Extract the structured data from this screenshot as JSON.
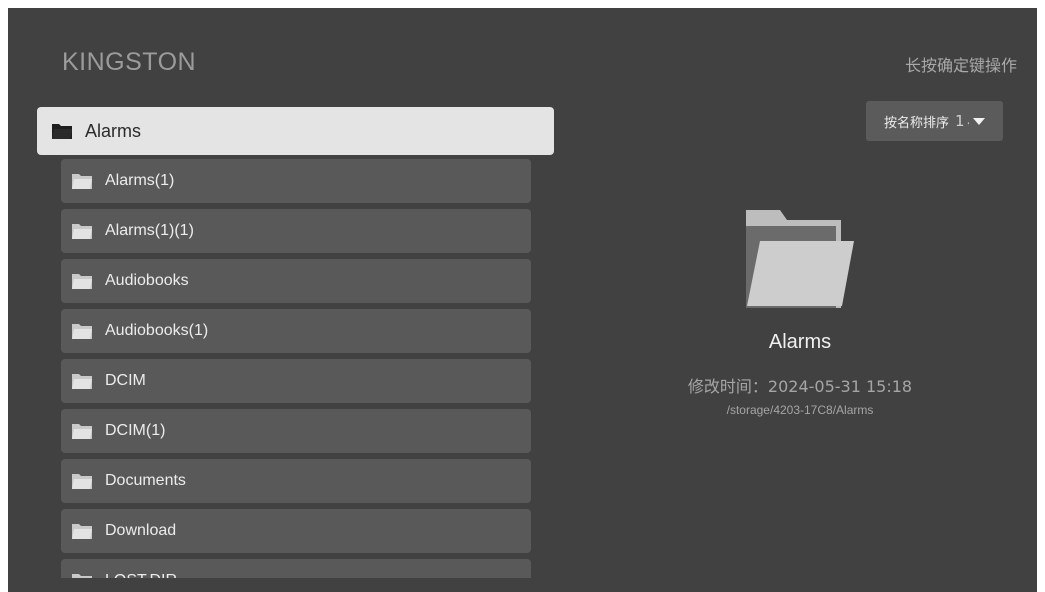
{
  "header": {
    "title": "KINGSTON",
    "hint": "长按确定键操作"
  },
  "sort": {
    "label": "按名称排序",
    "value": "1↓"
  },
  "selected_item": {
    "label": "Alarms",
    "icon": "folder-icon"
  },
  "folders": [
    {
      "label": "Alarms(1)",
      "icon": "folder-icon"
    },
    {
      "label": "Alarms(1)(1)",
      "icon": "folder-icon"
    },
    {
      "label": "Audiobooks",
      "icon": "folder-icon"
    },
    {
      "label": "Audiobooks(1)",
      "icon": "folder-icon"
    },
    {
      "label": "DCIM",
      "icon": "folder-icon"
    },
    {
      "label": "DCIM(1)",
      "icon": "folder-icon"
    },
    {
      "label": "Documents",
      "icon": "folder-icon"
    },
    {
      "label": "Download",
      "icon": "folder-icon"
    },
    {
      "label": "LOST.DIR",
      "icon": "folder-icon"
    }
  ],
  "preview": {
    "icon": "folder-open-icon",
    "name": "Alarms",
    "modified": "修改时间：2024-05-31 15:18",
    "path": "/storage/4203-17C8/Alarms"
  },
  "colors": {
    "background": "#414141",
    "row": "#595959",
    "selected_row": "#e4e4e4",
    "sort_button": "#5b5b5b"
  }
}
